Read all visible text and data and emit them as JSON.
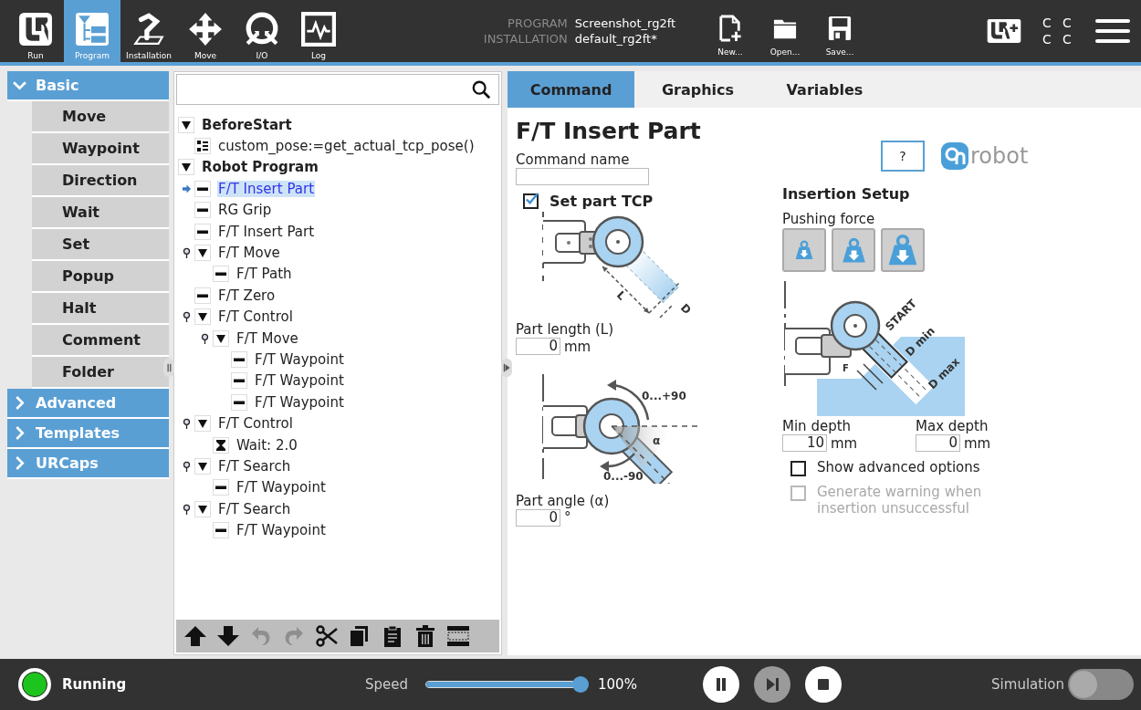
{
  "header": {
    "nav": [
      {
        "label": "Run",
        "kind": "run",
        "selected": false
      },
      {
        "label": "Program",
        "kind": "program",
        "selected": true
      },
      {
        "label": "Installation",
        "kind": "installation",
        "selected": false
      },
      {
        "label": "Move",
        "kind": "move",
        "selected": false
      },
      {
        "label": "I/O",
        "kind": "io",
        "selected": false
      },
      {
        "label": "Log",
        "kind": "log",
        "selected": false
      }
    ],
    "program": {
      "label": "PROGRAM",
      "value": "Screenshot_rg2ft"
    },
    "installation": {
      "label": "INSTALLATION",
      "value": "default_rg2ft*"
    },
    "file_buttons": [
      {
        "label": "New...",
        "kind": "new"
      },
      {
        "label": "Open...",
        "kind": "open"
      },
      {
        "label": "Save...",
        "kind": "save"
      }
    ],
    "status_letters": [
      "C",
      "C",
      "C",
      "C"
    ]
  },
  "sidebar": {
    "sections": [
      {
        "label": "Basic",
        "expanded": true,
        "items": [
          "Move",
          "Waypoint",
          "Direction",
          "Wait",
          "Set",
          "Popup",
          "Halt",
          "Comment",
          "Folder"
        ]
      },
      {
        "label": "Advanced",
        "expanded": false
      },
      {
        "label": "Templates",
        "expanded": false
      },
      {
        "label": "URCaps",
        "expanded": false
      }
    ]
  },
  "tree": {
    "nodes": [
      {
        "label": "BeforeStart",
        "kind": "section",
        "expanded": true,
        "selected": false,
        "children": [
          {
            "label": "custom_pose:=get_actual_tcp_pose()",
            "kind": "assign",
            "selected": false
          }
        ]
      },
      {
        "label": "Robot Program",
        "kind": "section",
        "expanded": true,
        "selected": false,
        "children": [
          {
            "label": "F/T Insert Part",
            "kind": "command",
            "selected": true
          },
          {
            "label": "RG Grip",
            "kind": "command",
            "selected": false
          },
          {
            "label": "F/T Insert Part",
            "kind": "command",
            "selected": false
          },
          {
            "label": "F/T Move",
            "kind": "group",
            "expanded": true,
            "selected": false,
            "children": [
              {
                "label": "F/T Path",
                "kind": "command",
                "selected": false
              }
            ]
          },
          {
            "label": "F/T Zero",
            "kind": "command",
            "selected": false
          },
          {
            "label": "F/T Control",
            "kind": "group",
            "expanded": true,
            "selected": false,
            "children": [
              {
                "label": "F/T Move",
                "kind": "group",
                "expanded": true,
                "selected": false,
                "children": [
                  {
                    "label": "F/T Waypoint",
                    "kind": "command",
                    "selected": false
                  },
                  {
                    "label": "F/T Waypoint",
                    "kind": "command",
                    "selected": false
                  },
                  {
                    "label": "F/T Waypoint",
                    "kind": "command",
                    "selected": false
                  }
                ]
              }
            ]
          },
          {
            "label": "F/T Control",
            "kind": "group",
            "expanded": true,
            "selected": false,
            "children": [
              {
                "label": "Wait: 2.0",
                "kind": "wait",
                "selected": false
              }
            ]
          },
          {
            "label": "F/T Search",
            "kind": "group",
            "expanded": true,
            "selected": false,
            "children": [
              {
                "label": "F/T Waypoint",
                "kind": "command",
                "selected": false
              }
            ]
          },
          {
            "label": "F/T Search",
            "kind": "group",
            "expanded": true,
            "selected": false,
            "children": [
              {
                "label": "F/T Waypoint",
                "kind": "command",
                "selected": false
              }
            ]
          }
        ]
      }
    ],
    "toolbar": [
      {
        "kind": "up",
        "disabled": false
      },
      {
        "kind": "down",
        "disabled": false
      },
      {
        "kind": "undo",
        "disabled": true
      },
      {
        "kind": "redo",
        "disabled": true
      },
      {
        "kind": "cut",
        "disabled": false
      },
      {
        "kind": "copy",
        "disabled": false
      },
      {
        "kind": "paste",
        "disabled": false
      },
      {
        "kind": "delete",
        "disabled": false
      },
      {
        "kind": "suppress",
        "disabled": false
      }
    ]
  },
  "panel": {
    "tabs": [
      {
        "label": "Command",
        "selected": true
      },
      {
        "label": "Graphics",
        "selected": false
      },
      {
        "label": "Variables",
        "selected": false
      }
    ],
    "title": "F/T Insert Part",
    "command_name": {
      "label": "Command name"
    },
    "help_button": "?",
    "logo": "robot",
    "set_part_tcp": {
      "label": "Set part TCP",
      "checked": true
    },
    "tcp_diagram": {
      "labels": [
        "L",
        "D"
      ]
    },
    "part_length": {
      "label": "Part length (L)",
      "value": "0",
      "unit": "mm"
    },
    "angle_diagram": {
      "labels": [
        "0...+90",
        "α",
        "0...-90"
      ]
    },
    "part_angle": {
      "label": "Part angle (α)",
      "value": "0",
      "unit": "°"
    },
    "insertion_setup": "Insertion Setup",
    "pushing_force": {
      "label": "Pushing force",
      "options": [
        {
          "selected": false
        },
        {
          "selected": false
        },
        {
          "selected": false
        }
      ]
    },
    "insertion_diagram": {
      "labels": [
        "START",
        "D min",
        "D max",
        "F"
      ]
    },
    "min_depth": {
      "label": "Min depth",
      "value": "10",
      "unit": "mm"
    },
    "max_depth": {
      "label": "Max depth",
      "value": "0",
      "unit": "mm"
    },
    "options": [
      {
        "label": "Show advanced options",
        "checked": false,
        "disabled": false
      },
      {
        "label": "Generate warning when insertion unsuccessful",
        "checked": false,
        "disabled": true
      }
    ]
  },
  "footer": {
    "status": {
      "label": "Running",
      "kind": "running"
    },
    "speed": {
      "label": "Speed",
      "level": 1,
      "reading": "100%"
    },
    "controls": [
      {
        "kind": "pause",
        "disabled": false
      },
      {
        "kind": "step",
        "disabled": true
      },
      {
        "kind": "stop",
        "disabled": false
      }
    ],
    "simulation": {
      "label": "Simulation",
      "on": false
    }
  }
}
